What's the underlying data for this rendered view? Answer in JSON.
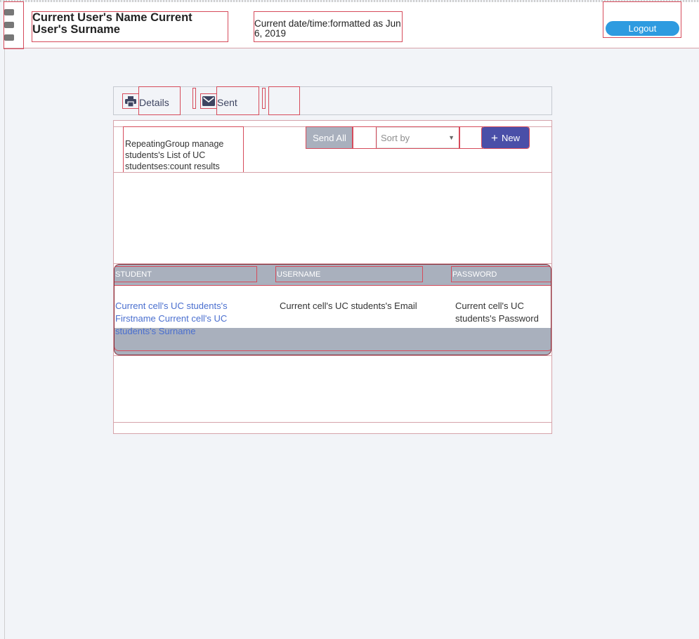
{
  "header": {
    "user_name": "Current User's Name Current User's Surname",
    "datetime": "Current date/time:formatted as Jun 6, 2019",
    "logout_label": "Logout"
  },
  "tabs": [
    {
      "label": "Details",
      "icon": "printer-icon"
    },
    {
      "label": "Sent",
      "icon": "envelope-icon"
    }
  ],
  "toolbar": {
    "count_text": "RepeatingGroup manage students's List of UC studentses:count results",
    "send_all_label": "Send All",
    "sort_placeholder": "Sort by",
    "new_label": "New"
  },
  "table": {
    "columns": [
      "STUDENT",
      "USERNAME",
      "PASSWORD"
    ],
    "row": {
      "student": "Current cell's UC students's Firstname Current cell's UC students's Surname",
      "username": "Current cell's UC students's Email",
      "password": "Current cell's UC students's Password"
    }
  },
  "colors": {
    "accent": "#2e9be0",
    "new_button": "#4a4fa8",
    "table_header": "#a9b0bd",
    "link": "#4a6fcf"
  }
}
